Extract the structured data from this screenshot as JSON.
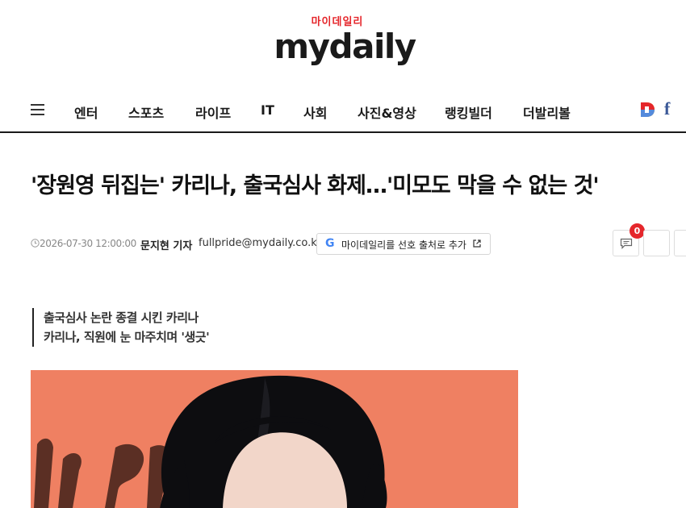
{
  "logo": {
    "korean": "마이데일리",
    "english": "mydaily"
  },
  "nav": {
    "items": [
      "엔터",
      "스포츠",
      "라이프",
      "IT",
      "사회",
      "사진&영상",
      "랭킹빌더",
      "더발리볼"
    ],
    "facebook_glyph": "f"
  },
  "article": {
    "headline": "'장원영 뒤집는' 카리나, 출국심사 화제…'미모도 막을 수 없는 것'",
    "date": "2026-07-30 12:00:00",
    "author": "문지현 기자",
    "email": "fullpride@mydaily.co.kr",
    "preferred_source_label": "마이데일리를 선호 출처로 추가",
    "comment_count": "0",
    "summary": [
      "출국심사 논란 종결 시킨 카리나",
      "카리나, 직원에 눈 마주치며 '생긋'"
    ]
  },
  "colors": {
    "brand_red": "#e5262b",
    "photo_bg": "#ef7a5e",
    "facebook_blue": "#3b5998"
  },
  "icons": [
    "hamburger-icon",
    "daum-icon",
    "facebook-icon",
    "clock-icon",
    "google-icon",
    "external-link-icon",
    "comment-icon"
  ]
}
